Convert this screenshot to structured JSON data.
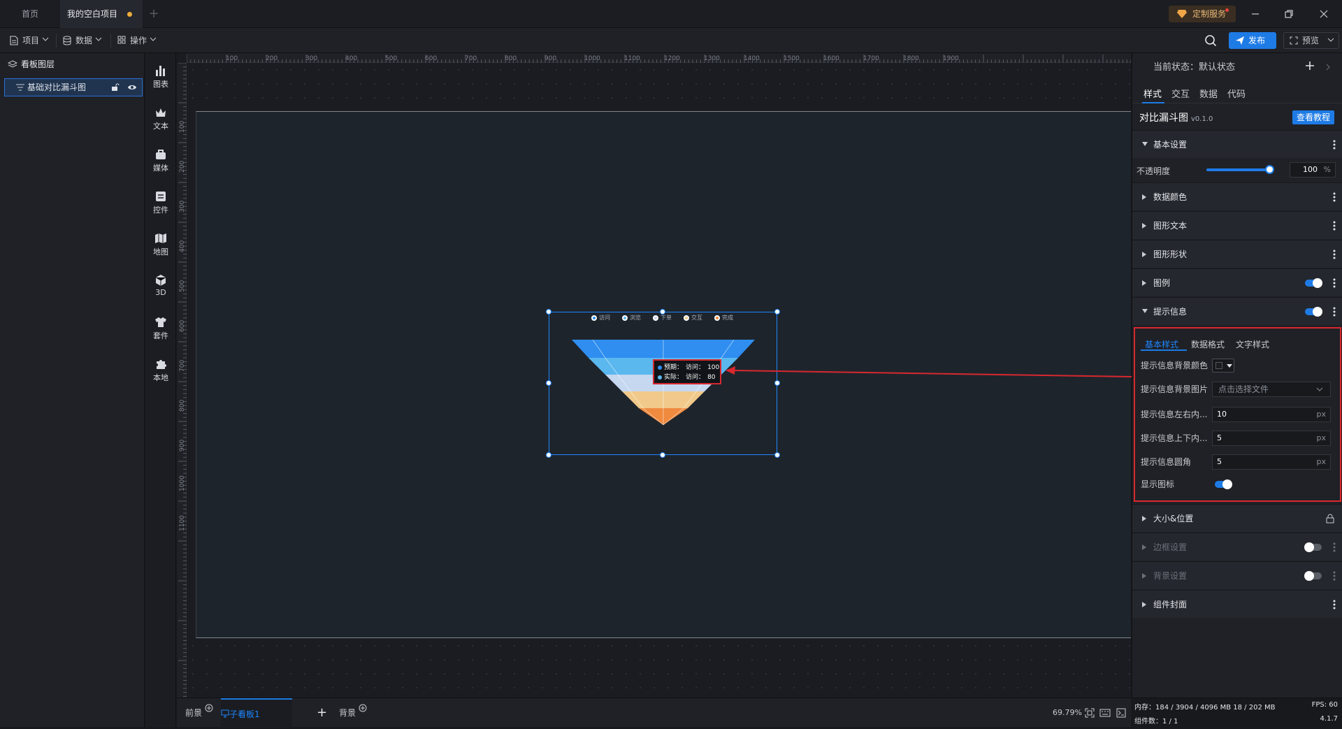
{
  "titlebar": {
    "tabs": [
      "首页",
      "我的空白项目"
    ],
    "custom_service": "定制服务"
  },
  "toolbar": {
    "menus": [
      "项目",
      "数据",
      "操作"
    ],
    "publish": "发布",
    "preview": "预览"
  },
  "layers": {
    "title": "看板图层",
    "items": [
      "基础对比漏斗图"
    ]
  },
  "components": [
    "图表",
    "文本",
    "媒体",
    "控件",
    "地图",
    "3D",
    "套件",
    "本地"
  ],
  "ruler": {
    "h": [
      "100",
      "200",
      "300",
      "400",
      "500",
      "600",
      "700",
      "800",
      "900",
      "1000",
      "1100",
      "1200",
      "1300",
      "1400",
      "1500",
      "1600",
      "1700",
      "1800",
      "1900"
    ],
    "v": [
      "100",
      "200",
      "300",
      "400",
      "500",
      "600",
      "700",
      "800",
      "900",
      "1000",
      "1100"
    ]
  },
  "chart": {
    "legend": [
      "访问",
      "浏览",
      "下单",
      "交互",
      "完成"
    ],
    "tooltip": [
      {
        "series": "预期",
        "metric": "访问",
        "value": "100"
      },
      {
        "series": "实际",
        "metric": "访问",
        "value": "80"
      }
    ],
    "colors": [
      "#2f8ef0",
      "#5ab8ef",
      "#c6d7f0",
      "#f1c98a",
      "#ef8a3f"
    ]
  },
  "bottombar": {
    "tabs": [
      "前景",
      "子看板1",
      "背景"
    ],
    "zoom": "69.79%"
  },
  "rpanel": {
    "state": "当前状态：默认状态",
    "tabs": [
      "样式",
      "交互",
      "数据",
      "代码"
    ],
    "component_title": "对比漏斗图",
    "component_version": "v0.1.0",
    "tutorial": "查看教程",
    "sections": {
      "basic": "基本设置",
      "data_color": "数据颜色",
      "graph_text": "图形文本",
      "graph_shape": "图形形状",
      "legend": "图例",
      "tooltip": "提示信息",
      "size_pos": "大小&位置",
      "border": "边框设置",
      "background": "背景设置",
      "cover": "组件封面"
    },
    "opacity": {
      "label": "不透明度",
      "value": "100",
      "unit": "%",
      "level_percent": 100
    },
    "tooltip_settings": {
      "tabs": [
        "基本样式",
        "数据格式",
        "文字样式"
      ],
      "bg_color_label": "提示信息背景颜色",
      "bg_image_label": "提示信息背景图片",
      "bg_image_placeholder": "点击选择文件",
      "pad_lr_label": "提示信息左右内...",
      "pad_lr_value": "10",
      "pad_tb_label": "提示信息上下内...",
      "pad_tb_value": "5",
      "radius_label": "提示信息圆角",
      "radius_value": "5",
      "unit": "px",
      "show_icon_label": "显示图标"
    }
  },
  "status": {
    "memory": "内存：184 / 3904 / 4096 MB 18 / 202 MB",
    "fps": "FPS: 60",
    "count": "组件数：1 / 1",
    "version": "4.1.7"
  }
}
